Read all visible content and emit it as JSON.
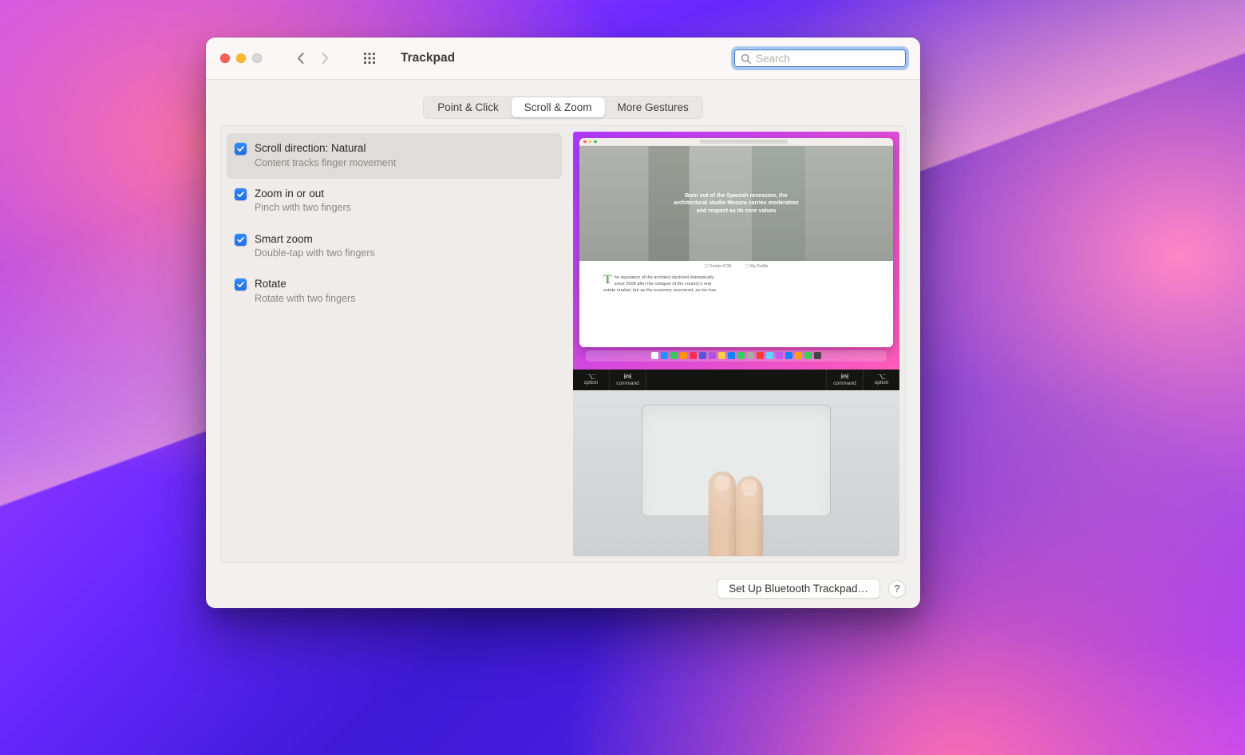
{
  "window": {
    "title": "Trackpad"
  },
  "search": {
    "placeholder": "Search"
  },
  "tabs": [
    {
      "id": "point-click",
      "label": "Point & Click",
      "active": false
    },
    {
      "id": "scroll-zoom",
      "label": "Scroll & Zoom",
      "active": true
    },
    {
      "id": "more-gestures",
      "label": "More Gestures",
      "active": false
    }
  ],
  "options": [
    {
      "id": "scroll-direction",
      "title": "Scroll direction: Natural",
      "subtitle": "Content tracks finger movement",
      "checked": true,
      "selected": true
    },
    {
      "id": "zoom-in-out",
      "title": "Zoom in or out",
      "subtitle": "Pinch with two fingers",
      "checked": true,
      "selected": false
    },
    {
      "id": "smart-zoom",
      "title": "Smart zoom",
      "subtitle": "Double-tap with two fingers",
      "checked": true,
      "selected": false
    },
    {
      "id": "rotate",
      "title": "Rotate",
      "subtitle": "Rotate with two fingers",
      "checked": true,
      "selected": false
    }
  ],
  "preview": {
    "hero_line1": "Born out of the Spanish recession, the",
    "hero_line2": "architectural studio Mesura carries moderation",
    "hero_line3": "and respect as its core values",
    "meta_left": "Trends 4739",
    "meta_right": "My Profile",
    "body_dropcap": "T",
    "body_line1": "he reputation of the architect declined dramatically",
    "body_line2": "since 2008 after the collapse of the country's real",
    "body_line3": "estate market, but as the economy recovered, so too has",
    "touchbar": {
      "left": [
        {
          "label": "option"
        },
        {
          "label": "command"
        }
      ],
      "right": [
        {
          "label": "command"
        },
        {
          "label": "option"
        }
      ]
    }
  },
  "footer": {
    "setup_button": "Set Up Bluetooth Trackpad…",
    "help_label": "?"
  },
  "colors": {
    "accent_blue": "#2478ff",
    "focus_ring": "#a9c8f0"
  }
}
